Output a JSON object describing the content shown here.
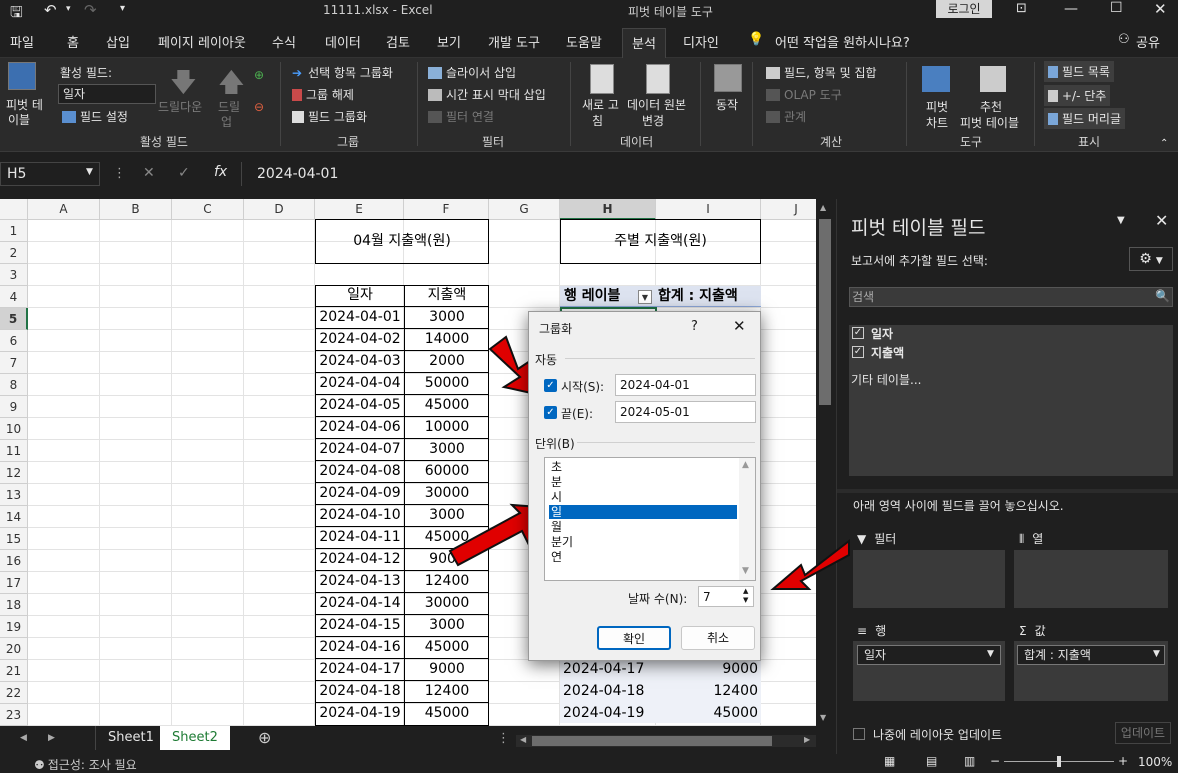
{
  "window": {
    "file": "11111.xlsx  -  Excel",
    "context": "피벗 테이블 도구",
    "login": "로그인"
  },
  "tabs": [
    "파일",
    "홈",
    "삽입",
    "페이지 레이아웃",
    "수식",
    "데이터",
    "검토",
    "보기",
    "개발 도구",
    "도움말",
    "분석",
    "디자인"
  ],
  "tell_me": "어떤 작업을 원하시나요?",
  "share": "공유",
  "ribbon": {
    "pivot_l1": "피벗 테",
    "pivot_l2": "이블",
    "active_field_label": "활성 필드:",
    "active_field_value": "일자",
    "field_settings": "필드 설정",
    "drill_down": "드릴다운",
    "drill_up_1": "드릴",
    "drill_up_2": "업",
    "group_active": "활성 필드",
    "group_selection": "선택 항목 그룹화",
    "ungroup": "그룹 해제",
    "group_field": "필드 그룹화",
    "group_group": "그룹",
    "insert_slicer": "슬라이서 삽입",
    "insert_timeline": "시간 표시 막대 삽입",
    "filter_connections": "필터 연결",
    "group_filter": "필터",
    "refresh_1": "새로 고",
    "refresh_2": "침",
    "change_source_1": "데이터 원본",
    "change_source_2": "변경",
    "group_data": "데이터",
    "actions": "동작",
    "fields_items_sets": "필드, 항목 및 집합",
    "olap_tools": "OLAP 도구",
    "relationships": "관계",
    "group_calc": "계산",
    "pivot_chart_1": "피벗",
    "pivot_chart_2": "차트",
    "recommended_1": "추천",
    "recommended_2": "피벗 테이블",
    "group_tools": "도구",
    "field_list": "필드 목록",
    "plus_minus": "+/- 단추",
    "field_headers": "필드 머리글",
    "group_show": "표시"
  },
  "formula": {
    "name_box": "H5",
    "fx": "fx",
    "value": "2024-04-01"
  },
  "columns": [
    "A",
    "B",
    "C",
    "D",
    "E",
    "F",
    "G",
    "H",
    "I",
    "J"
  ],
  "rows": [
    "1",
    "2",
    "3",
    "4",
    "5",
    "6",
    "7",
    "8",
    "9",
    "10",
    "11",
    "12",
    "13",
    "14",
    "15",
    "16",
    "17",
    "18",
    "19",
    "20",
    "21",
    "22",
    "23"
  ],
  "table": {
    "title": "04월 지출액(원)",
    "col1": "일자",
    "col2": "지출액",
    "dates": [
      "2024-04-01",
      "2024-04-02",
      "2024-04-03",
      "2024-04-04",
      "2024-04-05",
      "2024-04-06",
      "2024-04-07",
      "2024-04-08",
      "2024-04-09",
      "2024-04-10",
      "2024-04-11",
      "2024-04-12",
      "2024-04-13",
      "2024-04-14",
      "2024-04-15",
      "2024-04-16",
      "2024-04-17",
      "2024-04-18",
      "2024-04-19"
    ],
    "amounts": [
      "3000",
      "14000",
      "2000",
      "50000",
      "45000",
      "10000",
      "3000",
      "60000",
      "30000",
      "3000",
      "45000",
      "9000",
      "12400",
      "30000",
      "3000",
      "45000",
      "9000",
      "12400",
      "45000"
    ]
  },
  "pivot": {
    "title": "주별 지출액(원)",
    "row_label": "행 레이블",
    "sum_label": "합계 : 지출액",
    "visible_dates": [
      "2024-04-17",
      "2024-04-18",
      "2024-04-19"
    ],
    "visible_values": [
      "9000",
      "12400",
      "45000"
    ]
  },
  "sheets": [
    "Sheet1",
    "Sheet2"
  ],
  "status": {
    "accessibility": "접근성: 조사 필요",
    "zoom": "100%"
  },
  "dialog": {
    "title": "그룹화",
    "help": "?",
    "auto": "자동",
    "start_label": "시작(S):",
    "start_value": "2024-04-01",
    "end_label": "끝(E):",
    "end_value": "2024-05-01",
    "unit_label": "단위(B)",
    "units": [
      "초",
      "분",
      "시",
      "일",
      "월",
      "분기",
      "연"
    ],
    "selected_unit": "일",
    "days_label": "날짜 수(N):",
    "days_value": "7",
    "ok": "확인",
    "cancel": "취소"
  },
  "panel": {
    "title": "피벗 테이블 필드",
    "subtitle": "보고서에 추가할 필드 선택:",
    "search": "검색",
    "fields": [
      "일자",
      "지출액"
    ],
    "more_tables": "기타 테이블...",
    "drag_hint": "아래 영역 사이에 필드를 끌어 놓으십시오.",
    "filters": "필터",
    "columns": "열",
    "rows": "행",
    "values": "값",
    "rows_item": "일자",
    "values_item": "합계 : 지출액",
    "defer": "나중에 레이아웃 업데이트",
    "update": "업데이트"
  }
}
